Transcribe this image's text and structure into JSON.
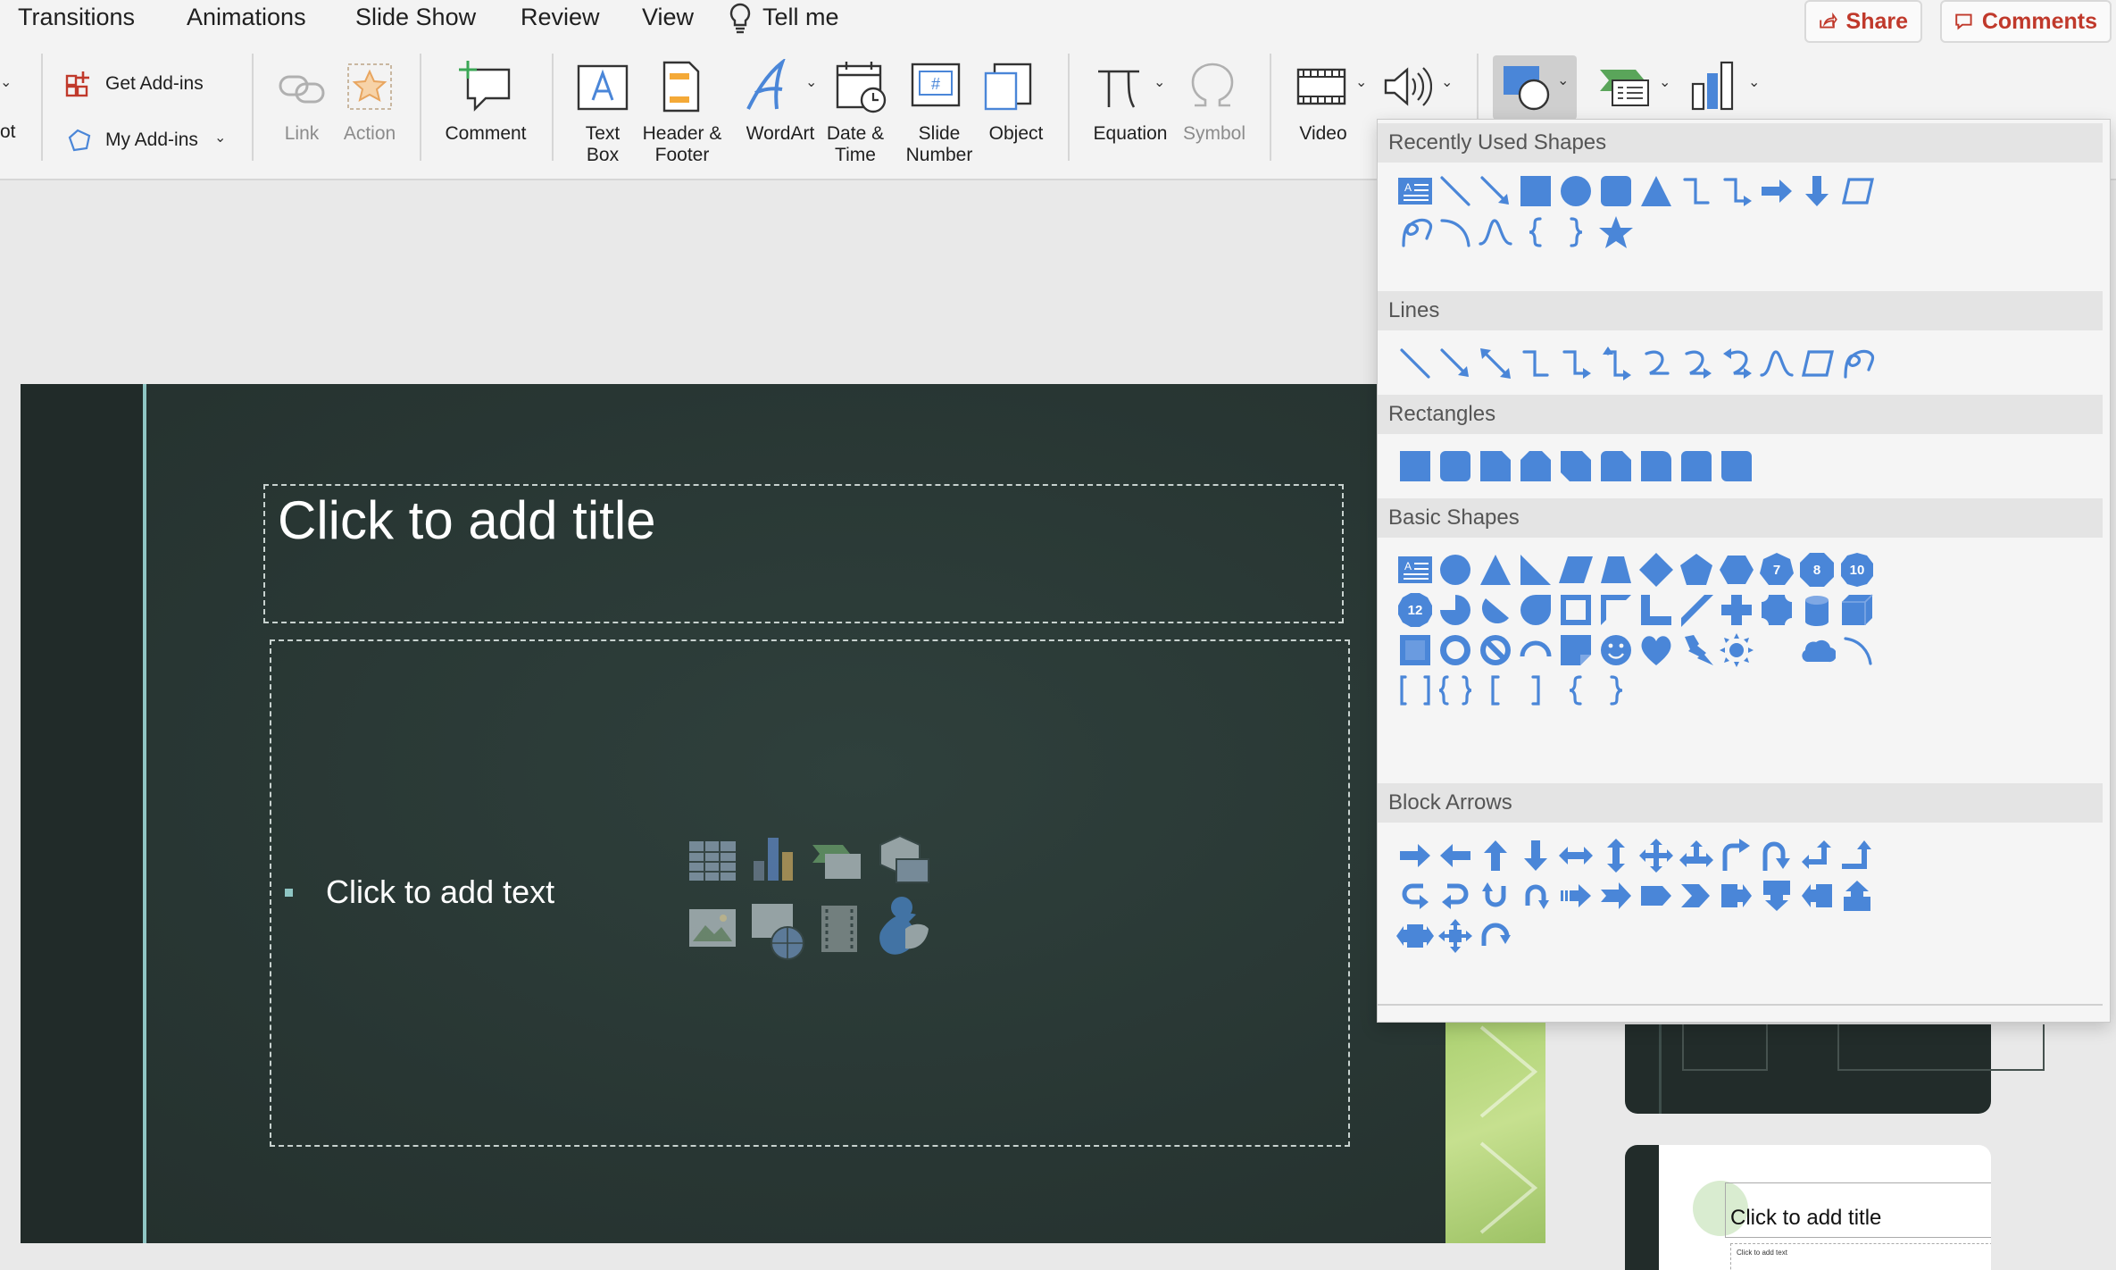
{
  "menu": {
    "tabs": [
      "Transitions",
      "Animations",
      "Slide Show",
      "Review",
      "View"
    ],
    "tell_me": "Tell me",
    "share": "Share",
    "comments": "Comments"
  },
  "ribbon": {
    "cut_label": "ot",
    "get_addins": "Get Add-ins",
    "my_addins": "My Add-ins",
    "link": "Link",
    "action": "Action",
    "comment": "Comment",
    "text_box_1": "Text",
    "text_box_2": "Box",
    "header_footer_1": "Header &",
    "header_footer_2": "Footer",
    "wordart": "WordArt",
    "date_time_1": "Date &",
    "date_time_2": "Time",
    "slide_number_1": "Slide",
    "slide_number_2": "Number",
    "object": "Object",
    "equation": "Equation",
    "symbol": "Symbol",
    "video": "Video"
  },
  "slide": {
    "title_placeholder": "Click to add title",
    "body_placeholder": "Click to add text"
  },
  "thumbnail": {
    "title": "Click to add title",
    "body": "Click to add text"
  },
  "gallery": {
    "sections": [
      "Recently Used Shapes",
      "Lines",
      "Rectangles",
      "Basic Shapes",
      "Block Arrows"
    ],
    "numbers": [
      "7",
      "8",
      "10",
      "12"
    ]
  },
  "colors": {
    "shape_blue": "#4a86d8",
    "accent_red": "#c0392b",
    "slide_bg": "#283633",
    "slide_accent_line": "#8fc6c4"
  }
}
